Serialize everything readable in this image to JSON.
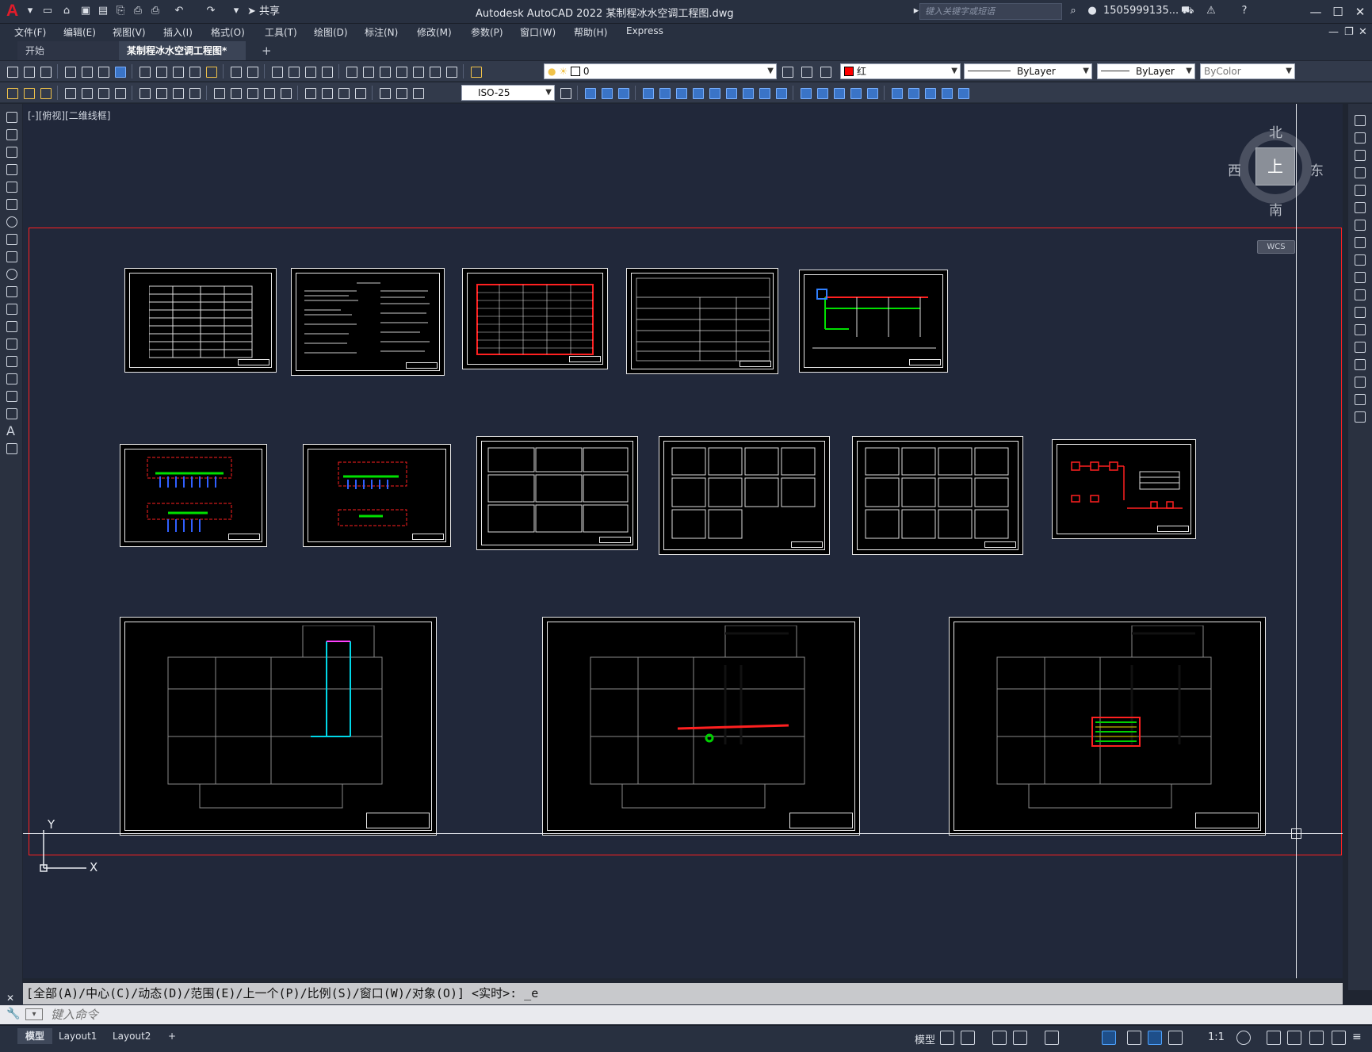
{
  "app": {
    "title": "Autodesk AutoCAD 2022    某制程冰水空调工程图.dwg",
    "share_label": "共享",
    "search_placeholder": "键入关键字或短语",
    "user": "1505999135... ▾",
    "logo_letter": "A"
  },
  "menu": {
    "items": [
      "文件(F)",
      "编辑(E)",
      "视图(V)",
      "插入(I)",
      "格式(O)",
      "工具(T)",
      "绘图(D)",
      "标注(N)",
      "修改(M)",
      "参数(P)",
      "窗口(W)",
      "帮助(H)",
      "Express"
    ]
  },
  "tabs": {
    "start": "开始",
    "active": "某制程冰水空调工程图*",
    "close": "✕",
    "add": "+"
  },
  "toolbar1": {
    "layer_value": "0",
    "color_value": "红",
    "linetype_value": "ByLayer",
    "lineweight_value": "ByLayer",
    "plotstyle_value": "ByColor"
  },
  "toolbar2": {
    "dimstyle_value": "ISO-25"
  },
  "drawing": {
    "viewport_label": "[-][俯视][二维线框]",
    "viewcube": {
      "face": "上",
      "north": "北",
      "south": "南",
      "east": "东",
      "west": "西",
      "wcs": "WCS"
    },
    "ucs": {
      "x": "X",
      "y": "Y"
    }
  },
  "command": {
    "history": "[全部(A)/中心(C)/动态(D)/范围(E)/上一个(P)/比例(S)/窗口(W)/对象(O)] <实时>: _e",
    "input_placeholder": "键入命令"
  },
  "status": {
    "layouts": [
      "模型",
      "Layout1",
      "Layout2"
    ],
    "add_layout": "+",
    "model_label": "模型",
    "scale": "1:1"
  },
  "colors": {
    "accent_red": "#ff2020",
    "background": "#21283a"
  }
}
